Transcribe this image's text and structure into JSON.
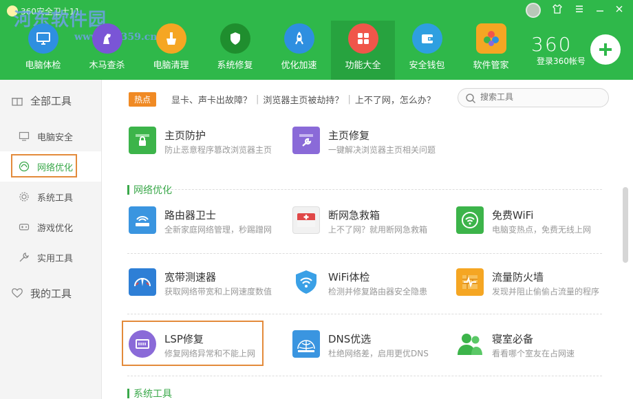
{
  "window": {
    "title": "360安全卫士11",
    "watermark": "河东软件园",
    "watermark_url": "www.pc0359.cn"
  },
  "nav": [
    {
      "label": "电脑体检",
      "icon": "monitor-icon",
      "color": "#2e8fe0"
    },
    {
      "label": "木马查杀",
      "icon": "horse-icon",
      "color": "#7a55d6"
    },
    {
      "label": "电脑清理",
      "icon": "broom-icon",
      "color": "#f5a623"
    },
    {
      "label": "系统修复",
      "icon": "shield-icon",
      "color": "#1f8e2e"
    },
    {
      "label": "优化加速",
      "icon": "rocket-icon",
      "color": "#2e8fe0"
    },
    {
      "label": "功能大全",
      "icon": "grid-icon",
      "color": "#f0564a"
    },
    {
      "label": "安全钱包",
      "icon": "wallet-icon",
      "color": "#2e9fe0"
    },
    {
      "label": "软件管家",
      "icon": "apps-icon",
      "color": "#f5a623"
    }
  ],
  "header": {
    "brand": "360",
    "login": "登录360帐号"
  },
  "sidebar": {
    "all_tools": "全部工具",
    "items": [
      {
        "label": "电脑安全"
      },
      {
        "label": "网络优化"
      },
      {
        "label": "系统工具"
      },
      {
        "label": "游戏优化"
      },
      {
        "label": "实用工具"
      }
    ],
    "my_tools": "我的工具"
  },
  "hotbar": {
    "badge": "热点",
    "links": [
      "显卡、声卡出故障？",
      "浏览器主页被劫持？",
      "上不了网，怎么办？"
    ]
  },
  "search": {
    "placeholder": "搜索工具"
  },
  "top_tools": [
    {
      "title": "主页防护",
      "desc": "防止恶意程序篡改浏览器主页",
      "icon": "lock-icon",
      "color": "#3cb44a"
    },
    {
      "title": "主页修复",
      "desc": "一键解决浏览器主页相关问题",
      "icon": "wrench-icon",
      "color": "#8a6ad8"
    }
  ],
  "sections": [
    {
      "title": "网络优化"
    },
    {
      "title": "系统工具"
    }
  ],
  "net_tools": [
    {
      "title": "路由器卫士",
      "desc": "全新家庭网络管理，秒踢蹭网",
      "icon": "router-icon",
      "color": "#3a95e0"
    },
    {
      "title": "断网急救箱",
      "desc": "上不了网？就用断网急救箱",
      "icon": "first-aid-icon",
      "color": "#e04848"
    },
    {
      "title": "免费WiFi",
      "desc": "电脑变热点，免费无线上网",
      "icon": "wifi-icon",
      "color": "#3cb44a"
    },
    {
      "title": "宽带测速器",
      "desc": "获取网络带宽和上网速度数值",
      "icon": "speedometer-icon",
      "color": "#2e7fd6"
    },
    {
      "title": "WiFi体检",
      "desc": "检测并修复路由器安全隐患",
      "icon": "wifi-shield-icon",
      "color": "#3aa0e6"
    },
    {
      "title": "流量防火墙",
      "desc": "发现并阻止偷偷占流量的程序",
      "icon": "firewall-icon",
      "color": "#f5a623"
    },
    {
      "title": "LSP修复",
      "desc": "修复网络异常和不能上网",
      "icon": "network-card-icon",
      "color": "#8a6ad8"
    },
    {
      "title": "DNS优选",
      "desc": "杜绝网络差，启用更优DNS",
      "icon": "globe-icon",
      "color": "#3a95e0"
    },
    {
      "title": "寝室必备",
      "desc": "看看哪个室友在占网速",
      "icon": "users-icon",
      "color": "#3cb44a"
    }
  ]
}
